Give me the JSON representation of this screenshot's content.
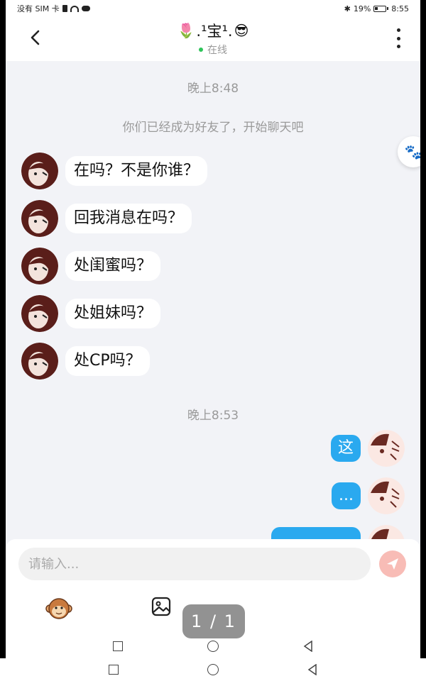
{
  "status_bar": {
    "carrier": "没有 SIM 卡",
    "battery": "19%",
    "battery_level": 0.19,
    "time": "8:55"
  },
  "header": {
    "title": ".¹宝¹.",
    "title_leading_emoji": "🌷",
    "title_trailing_emoji": "😎",
    "status": "在线",
    "status_color": "#2ec45a"
  },
  "chat": {
    "time1": "晚上8:48",
    "system_message": "你们已经成为好友了，开始聊天吧",
    "incoming": [
      {
        "text": "在吗？不是你谁？"
      },
      {
        "text": "回我消息在吗？"
      },
      {
        "text": "处闺蜜吗？"
      },
      {
        "text": "处姐妹吗？"
      },
      {
        "text": "处CP吗？"
      }
    ],
    "time2": "晚上8:53",
    "outgoing": [
      {
        "text": "这"
      },
      {
        "text": "..."
      },
      {
        "text": ""
      }
    ],
    "bubble_out_color": "#2aa9ef"
  },
  "input": {
    "placeholder": "请输入...",
    "send_color": "#f8bcb6"
  },
  "pager": {
    "text": "1 / 1"
  }
}
